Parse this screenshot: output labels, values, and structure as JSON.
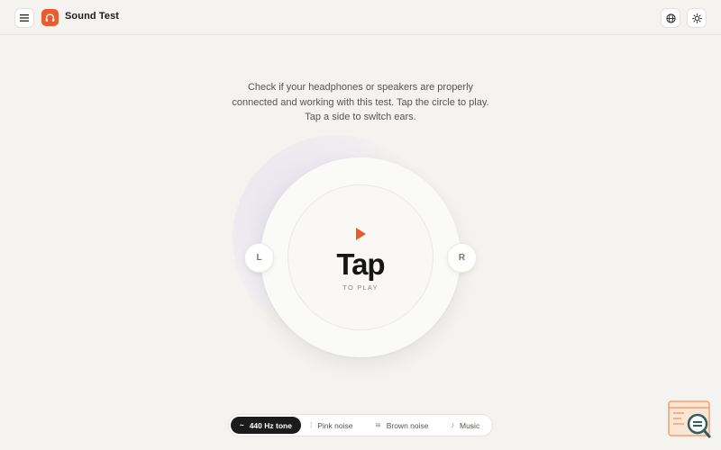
{
  "header": {
    "app_title": "Sound Test",
    "menu_icon": "hamburger-menu-icon",
    "logo_icon": "headphones-icon",
    "globe_icon": "globe-icon",
    "theme_icon": "sun-icon"
  },
  "main": {
    "description": "Check if your headphones or speakers are properly connected and working with this test. Tap the circle to play. Tap a side to switch ears.",
    "tap_label": "Tap",
    "tap_sublabel": "TO PLAY",
    "left_label": "L",
    "right_label": "R",
    "play_icon": "play-icon"
  },
  "sound_options": [
    {
      "label": "440 Hz tone",
      "icon": "~",
      "active": true
    },
    {
      "label": "Pink noise",
      "icon": "⁞",
      "active": false
    },
    {
      "label": "Brown noise",
      "icon": "≋",
      "active": false
    },
    {
      "label": "Music",
      "icon": "♪",
      "active": false
    }
  ],
  "colors": {
    "accent": "#e85d2f",
    "background": "#f4f3f0",
    "active_pill": "#1b1b1b",
    "widget_orange": "#f0a070",
    "widget_teal": "#2f5f5f"
  }
}
